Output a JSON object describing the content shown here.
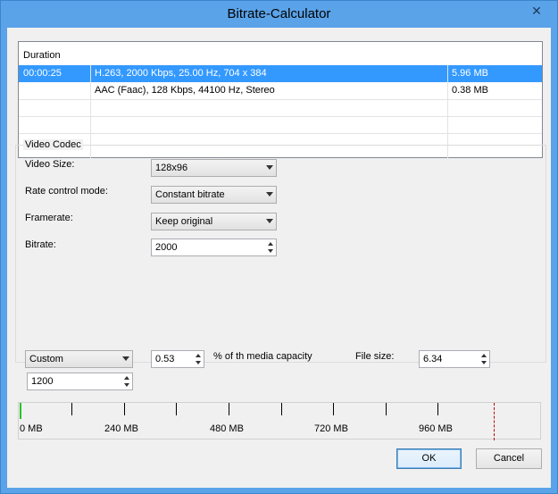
{
  "window": {
    "title": "Bitrate-Calculator",
    "close_glyph": "✕"
  },
  "listview": {
    "header": "Duration",
    "rows": [
      {
        "duration": "00:00:25",
        "codec": "H.263, 2000 Kbps, 25.00 Hz, 704 x 384",
        "size": "5.96 MB",
        "selected": true
      },
      {
        "duration": "",
        "codec": "AAC (Faac), 128 Kbps, 44100 Hz, Stereo",
        "size": "0.38 MB",
        "selected": false
      }
    ]
  },
  "video_codec": {
    "group_label": "Video Codec",
    "video_size": {
      "label": "Video Size:",
      "value": "128x96"
    },
    "rate_control": {
      "label": "Rate control mode:",
      "value": "Constant bitrate"
    },
    "framerate": {
      "label": "Framerate:",
      "value": "Keep original"
    },
    "bitrate": {
      "label": "Bitrate:",
      "value": "2000"
    }
  },
  "capacity": {
    "preset": "Custom",
    "percent": "0.53",
    "percent_label": "% of th media capacity",
    "file_size_label": "File size:",
    "file_size": "6.34",
    "custom_size": "1200"
  },
  "ruler": {
    "labels": [
      "0 MB",
      "240 MB",
      "480 MB",
      "720 MB",
      "960 MB"
    ]
  },
  "buttons": {
    "ok": "OK",
    "cancel": "Cancel"
  }
}
